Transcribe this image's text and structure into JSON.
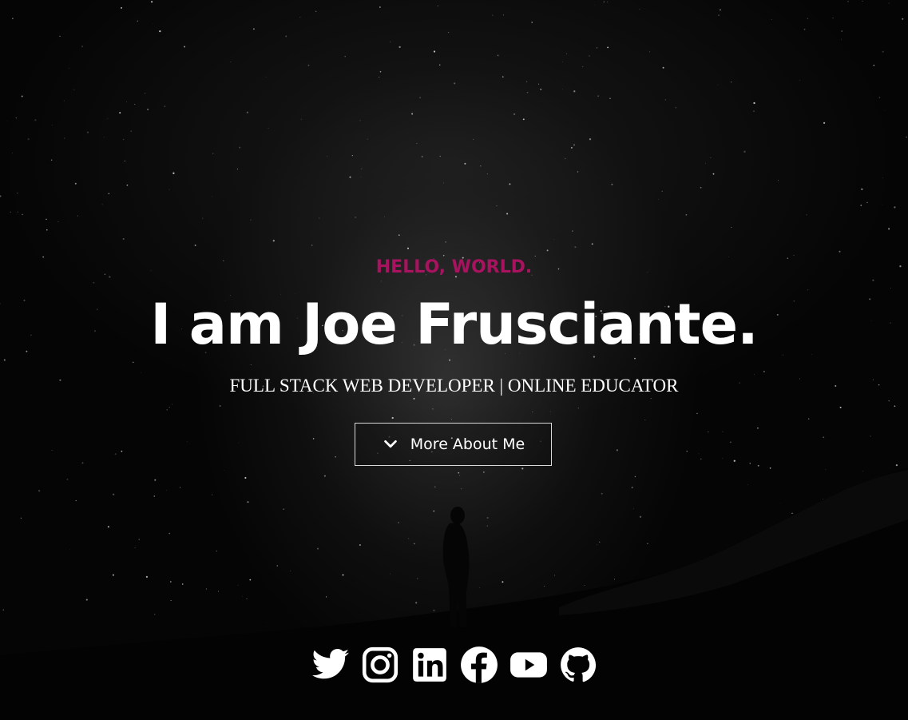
{
  "hero": {
    "kicker": "HELLO, WORLD.",
    "headline": "I am Joe Frusciante.",
    "tagline": "FULL STACK WEB DEVELOPER | ONLINE EDUCATOR",
    "cta_label": "More About Me",
    "cta_icon": "chevron-down-icon",
    "accent_color": "#a8125f"
  },
  "social": [
    {
      "name": "Twitter",
      "icon": "twitter-icon"
    },
    {
      "name": "Instagram",
      "icon": "instagram-icon"
    },
    {
      "name": "LinkedIn",
      "icon": "linkedin-icon"
    },
    {
      "name": "Facebook",
      "icon": "facebook-icon"
    },
    {
      "name": "YouTube",
      "icon": "youtube-icon"
    },
    {
      "name": "GitHub",
      "icon": "github-icon"
    }
  ]
}
